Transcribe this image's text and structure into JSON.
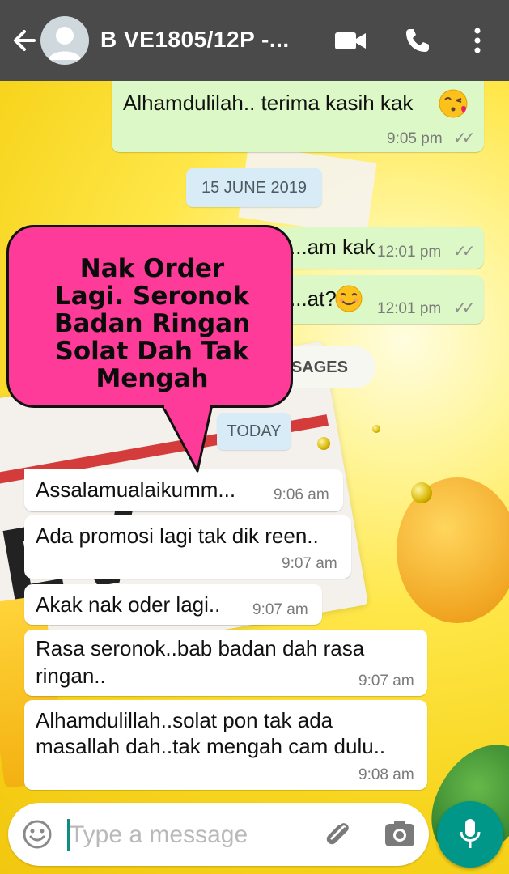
{
  "header": {
    "contact_name": "B VE1805/12P -...",
    "icons": [
      "back-arrow-icon",
      "avatar-icon",
      "video-call-icon",
      "phone-icon",
      "more-options-icon"
    ]
  },
  "messages_before": [
    {
      "text": "Alhamdulilah.. terima kasih kak",
      "emoji": "kissing-face-heart-icon",
      "time": "9:05 pm",
      "direction": "outgoing",
      "status": "read"
    },
    {
      "text": "...am kak",
      "time": "12:01 pm",
      "direction": "outgoing",
      "status": "read"
    },
    {
      "text": "...at?",
      "emoji": "smiling-face-icon",
      "time": "12:01 pm",
      "direction": "outgoing",
      "status": "read"
    }
  ],
  "date_divider": "15 JUNE 2019",
  "unread_label": "...SAGES",
  "today_divider": "TODAY",
  "callout": {
    "text": "Nak Order Lagi. Seronok Badan Ringan Solat Dah Tak Mengah",
    "line1": "Nak Order",
    "line2": "Lagi. Seronok",
    "line3": "Badan Ringan",
    "line4": "Solat Dah Tak",
    "line5": "Mengah",
    "color": "#ff3b9a"
  },
  "messages_today": [
    {
      "text": "Assalamualaikumm...",
      "time": "9:06 am",
      "direction": "incoming"
    },
    {
      "text": "Ada promosi lagi tak dik reen..",
      "time": "9:07 am",
      "direction": "incoming"
    },
    {
      "text": "Akak nak oder lagi..",
      "time": "9:07 am",
      "direction": "incoming"
    },
    {
      "text": "Rasa seronok..bab badan dah rasa ringan..",
      "line1": "Rasa seronok..bab badan dah rasa",
      "line2": "ringan..",
      "time": "9:07 am",
      "direction": "incoming"
    },
    {
      "text": "Alhamdulillah..solat pon tak ada masallah dah..tak mengah cam dulu..",
      "line1": "Alhamdulillah..solat pon tak ada",
      "line2": "masallah dah..tak mengah cam dulu..",
      "time": "9:08 am",
      "direction": "incoming"
    }
  ],
  "composer": {
    "placeholder": "Type a message",
    "icons": [
      "emoji-icon",
      "attach-icon",
      "camera-icon",
      "mic-icon"
    ]
  },
  "colors": {
    "topbar": "#4a4a4a",
    "outgoing_bubble": "#dcf8c6",
    "incoming_bubble": "#ffffff",
    "mic_button": "#009688",
    "date_pill": "#d7ecf7"
  }
}
